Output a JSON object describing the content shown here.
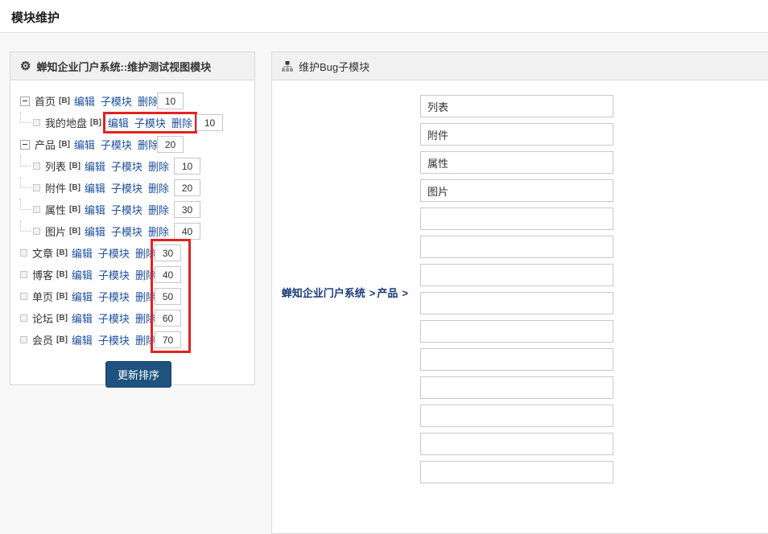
{
  "page": {
    "title": "模块维护"
  },
  "left_panel": {
    "title": "蝉知企业门户系统::维护测试视图模块",
    "action_labels": [
      "编辑",
      "子模块",
      "删除"
    ],
    "update_button": "更新排序",
    "tree": [
      {
        "label": "首页",
        "tag": "[B]",
        "order": "10",
        "type": "parent",
        "highlighted": false
      },
      {
        "label": "我的地盘",
        "tag": "[B]",
        "order": "10",
        "type": "child",
        "highlighted": true
      },
      {
        "label": "产品",
        "tag": "[B]",
        "order": "20",
        "type": "parent",
        "highlighted": false
      },
      {
        "label": "列表",
        "tag": "[B]",
        "order": "10",
        "type": "child",
        "highlighted": false
      },
      {
        "label": "附件",
        "tag": "[B]",
        "order": "20",
        "type": "child",
        "highlighted": false
      },
      {
        "label": "属性",
        "tag": "[B]",
        "order": "30",
        "type": "child",
        "highlighted": false
      },
      {
        "label": "图片",
        "tag": "[B]",
        "order": "40",
        "type": "child",
        "highlighted": false
      },
      {
        "label": "文章",
        "tag": "[B]",
        "order": "30",
        "type": "leaf",
        "highlighted": false
      },
      {
        "label": "博客",
        "tag": "[B]",
        "order": "40",
        "type": "leaf",
        "highlighted": false
      },
      {
        "label": "单页",
        "tag": "[B]",
        "order": "50",
        "type": "leaf",
        "highlighted": false
      },
      {
        "label": "论坛",
        "tag": "[B]",
        "order": "60",
        "type": "leaf",
        "highlighted": false
      },
      {
        "label": "会员",
        "tag": "[B]",
        "order": "70",
        "type": "leaf",
        "highlighted": false
      }
    ]
  },
  "right_panel": {
    "title": "维护Bug子模块",
    "breadcrumb": {
      "root": "蝉知企业门户系统",
      "separator": ">",
      "current": "产品"
    },
    "inputs": [
      "列表",
      "附件",
      "属性",
      "图片",
      "",
      "",
      "",
      "",
      "",
      "",
      "",
      "",
      "",
      ""
    ]
  },
  "colors": {
    "link": "#1c4f9c",
    "breadcrumb": "#1b3b78",
    "button_bg": "#1e5380",
    "annotation_red": "#e02420",
    "panel_header_bg": "#f1f1f1",
    "panel_border": "#d9d9d9"
  }
}
